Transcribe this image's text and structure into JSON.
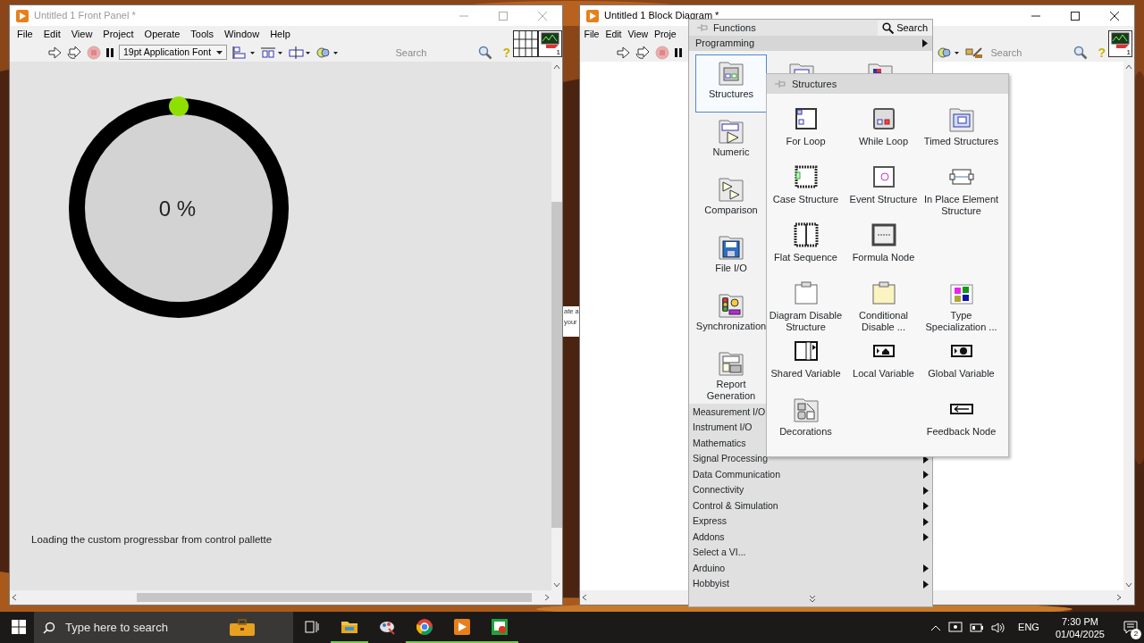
{
  "front_panel": {
    "title": "Untitled 1 Front Panel *",
    "active": false,
    "menu": [
      "File",
      "Edit",
      "View",
      "Project",
      "Operate",
      "Tools",
      "Window",
      "Help"
    ],
    "font_selector": "19pt Application Font",
    "search": {
      "placeholder": "Search"
    },
    "help": "?",
    "vi_icon_number": "1",
    "gauge": {
      "reading": "0 %"
    },
    "label": "Loading the custom progressbar from control pallette"
  },
  "background_window": {
    "lines": [
      "ate a",
      "your"
    ]
  },
  "block_diagram": {
    "title": "Untitled 1 Block Diagram *",
    "active": true,
    "menu": [
      "File",
      "Edit",
      "View",
      "Proje"
    ],
    "search": {
      "placeholder": "Search"
    },
    "help": "?",
    "vi_icon_number": "1"
  },
  "functions_palette": {
    "title": "Functions",
    "search_button": "Search",
    "category": "Programming",
    "tiles": [
      {
        "label": "Structures",
        "selected": true
      },
      {
        "label": "Numeric",
        "selected": false
      },
      {
        "label": "Comparison",
        "selected": false
      },
      {
        "label": "File I/O",
        "selected": false
      },
      {
        "label": "Synchronization",
        "selected": false
      },
      {
        "label": "Report Generation",
        "selected": false
      }
    ],
    "items": [
      {
        "label": "Measurement I/O"
      },
      {
        "label": "Instrument I/O"
      },
      {
        "label": "Mathematics"
      },
      {
        "label": "Signal Processing",
        "submenu": true
      },
      {
        "label": "Data Communication",
        "submenu": true
      },
      {
        "label": "Connectivity",
        "submenu": true
      },
      {
        "label": "Control & Simulation",
        "submenu": true
      },
      {
        "label": "Express",
        "submenu": true
      },
      {
        "label": "Addons",
        "submenu": true
      },
      {
        "label": "Select a VI...",
        "submenu": false
      },
      {
        "label": "Arduino",
        "submenu": true
      },
      {
        "label": "Hobbyist",
        "submenu": true
      }
    ]
  },
  "structures_panel": {
    "title": "Structures",
    "items": [
      {
        "kind": "item",
        "label": "For Loop"
      },
      {
        "kind": "item",
        "label": "While Loop"
      },
      {
        "kind": "item",
        "label": "Timed Structures"
      },
      {
        "kind": "item",
        "label": "Case Structure"
      },
      {
        "kind": "item",
        "label": "Event Structure"
      },
      {
        "kind": "item",
        "label": "In Place Element Structure"
      },
      {
        "kind": "item",
        "label": "Flat Sequence"
      },
      {
        "kind": "item",
        "label": "Formula Node"
      },
      {
        "kind": "blank"
      },
      {
        "kind": "item",
        "label": "Diagram Disable Structure"
      },
      {
        "kind": "item",
        "label": "Conditional Disable ..."
      },
      {
        "kind": "item",
        "label": "Type Specialization ..."
      },
      {
        "kind": "item",
        "label": "Shared Variable"
      },
      {
        "kind": "item",
        "label": "Local Variable"
      },
      {
        "kind": "item",
        "label": "Global Variable"
      },
      {
        "kind": "item",
        "label": "Decorations"
      },
      {
        "kind": "blank"
      },
      {
        "kind": "item",
        "label": "Feedback Node"
      }
    ]
  },
  "taskbar": {
    "search": {
      "placeholder": "Type here to search"
    },
    "apps": [
      {
        "running": true
      },
      {
        "running": false
      },
      {
        "running": true
      },
      {
        "running": true
      },
      {
        "running": true
      }
    ],
    "language": "ENG",
    "time": "7:30 PM",
    "date": "01/04/2025",
    "notifications": "2"
  }
}
